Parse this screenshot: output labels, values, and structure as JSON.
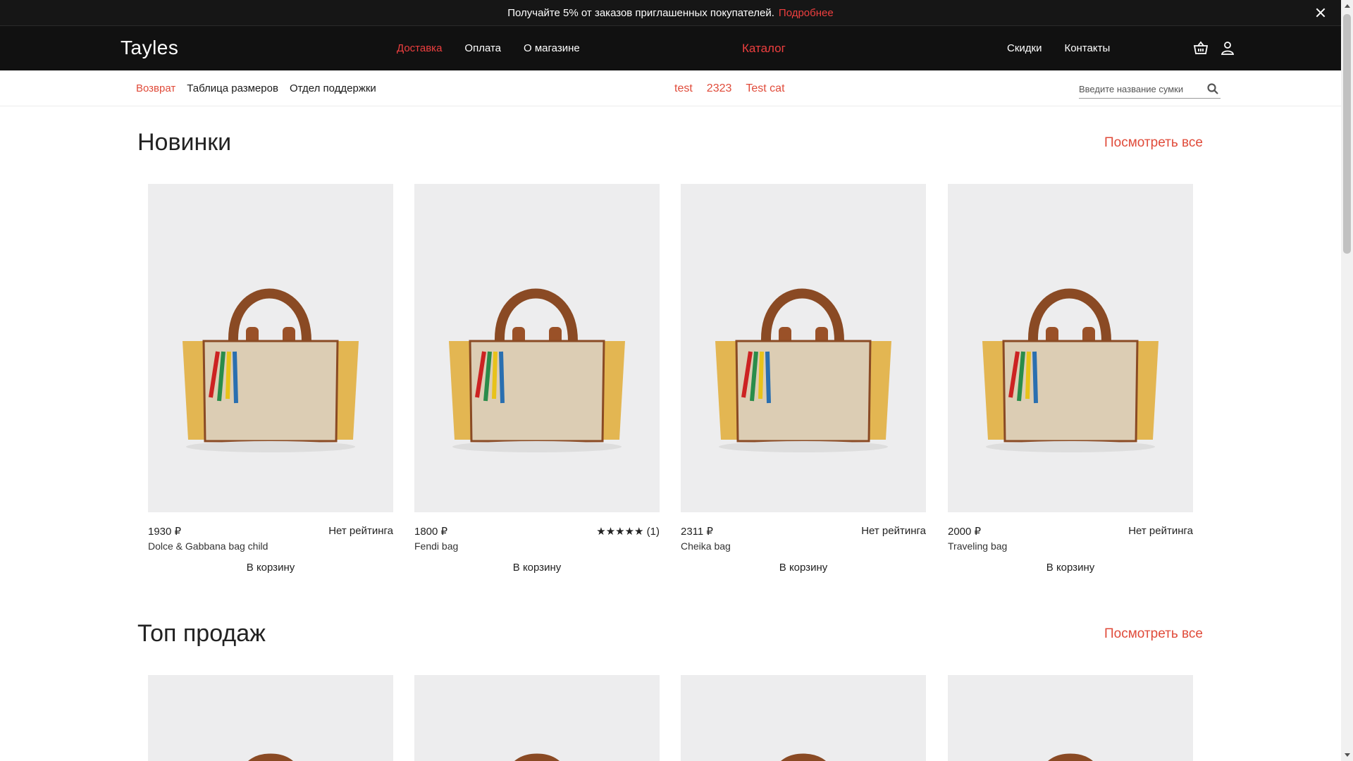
{
  "promo": {
    "text": "Получайте 5% от заказов приглашенных покупателей.",
    "link": "Подробнее"
  },
  "nav": {
    "logo": "Tayles",
    "left": [
      "Доставка",
      "Оплата",
      "О магазине"
    ],
    "catalog": "Каталог",
    "right": [
      "Скидки",
      "Контакты"
    ]
  },
  "subnav": {
    "left": [
      "Возврат",
      "Таблица размеров",
      "Отдел поддержки"
    ],
    "categories": [
      "test",
      "2323",
      "Test cat"
    ],
    "search_placeholder": "Введите название сумки"
  },
  "sections": [
    {
      "title": "Новинки",
      "see_all": "Посмотреть все",
      "products": [
        {
          "price": "1930 ₽",
          "rating": "Нет рейтинга",
          "name": "Dolce & Gabbana bag child",
          "cart": "В корзину"
        },
        {
          "price": "1800 ₽",
          "rating": "★★★★★ (1)",
          "name": "Fendi bag",
          "cart": "В корзину"
        },
        {
          "price": "2311 ₽",
          "rating": "Нет рейтинга",
          "name": "Cheika bag",
          "cart": "В корзину"
        },
        {
          "price": "2000 ₽",
          "rating": "Нет рейтинга",
          "name": "Traveling bag",
          "cart": "В корзину"
        }
      ]
    },
    {
      "title": "Топ продаж",
      "see_all": "Посмотреть все"
    }
  ],
  "colors": {
    "accent": "#e04b3a",
    "nav_bg": "#111111",
    "card_bg": "#ededee"
  },
  "icons": [
    "close-icon",
    "basket-icon",
    "user-icon",
    "search-icon",
    "bag-image"
  ]
}
